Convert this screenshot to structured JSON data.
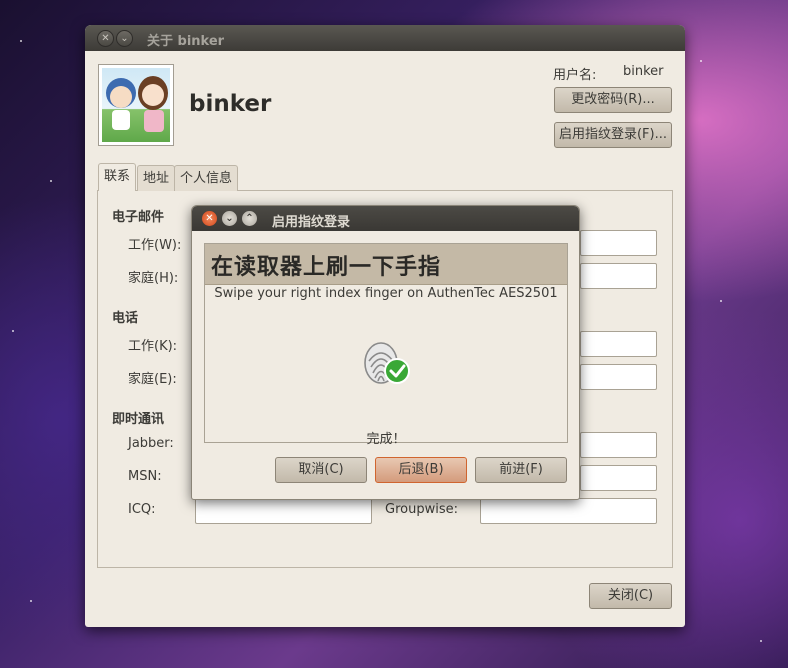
{
  "window": {
    "title": "关于 binker",
    "display_name": "binker",
    "username_label": "用户名:",
    "username_value": "binker",
    "change_password_button": "更改密码(R)...",
    "fingerprint_button": "启用指纹登录(F)...",
    "tabs": [
      {
        "label": "联系",
        "active": true
      },
      {
        "label": "地址",
        "active": false
      },
      {
        "label": "个人信息",
        "active": false
      }
    ],
    "email_section": "电子邮件",
    "email_work_label": "工作(W):",
    "email_home_label": "家庭(H):",
    "phone_section": "电话",
    "phone_work_label": "工作(K):",
    "phone_home_label": "家庭(E):",
    "im_section": "即时通讯",
    "jabber_label": "Jabber:",
    "msn_label": "MSN:",
    "icq_label": "ICQ:",
    "groupwise_label": "Groupwise:",
    "close_button": "关闭(C)"
  },
  "dialog": {
    "title": "启用指纹登录",
    "header": "在读取器上刷一下手指",
    "instruction": "Swipe your right index finger on AuthenTec AES2501",
    "status": "完成！",
    "cancel_button": "取消(C)",
    "back_button": "后退(B)",
    "forward_button": "前进(F)"
  },
  "colors": {
    "accent": "#dd4814",
    "check_green": "#3aa836",
    "header_bg": "#c4b9a6"
  },
  "icons": [
    "close-icon",
    "minimize-icon",
    "maximize-icon",
    "fingerprint-icon",
    "checkmark-icon"
  ]
}
